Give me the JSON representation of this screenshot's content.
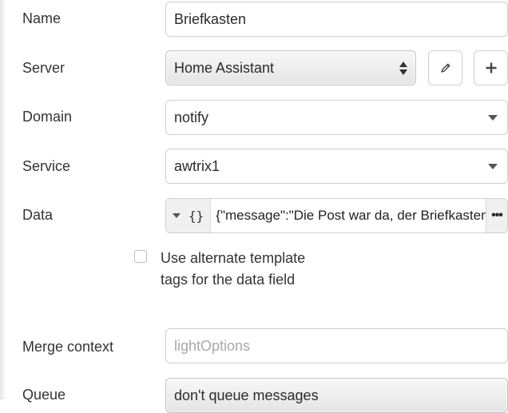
{
  "form": {
    "name": {
      "label": "Name",
      "value": "Briefkasten"
    },
    "server": {
      "label": "Server",
      "value": "Home Assistant",
      "edit_icon": "pencil-icon",
      "add_icon": "plus-icon"
    },
    "domain": {
      "label": "Domain",
      "value": "notify"
    },
    "service": {
      "label": "Service",
      "value": "awtrix1"
    },
    "data": {
      "label": "Data",
      "type_symbol": "{}",
      "value": "{\"message\":\"Die Post war da, der Briefkasten\"}",
      "more": "•••"
    },
    "alt_tags": {
      "checked": false,
      "label": "Use alternate template tags for the data field"
    },
    "merge_context": {
      "label": "Merge context",
      "placeholder": "lightOptions",
      "value": ""
    },
    "queue": {
      "label": "Queue",
      "value": "don't queue messages"
    }
  }
}
